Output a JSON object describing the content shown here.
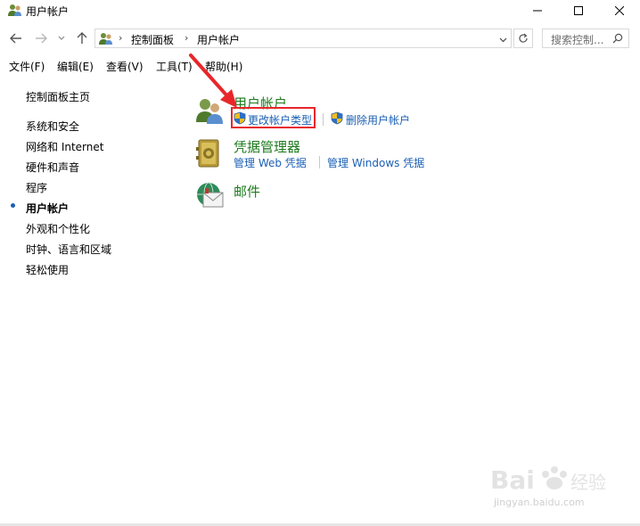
{
  "window": {
    "title": "用户帐户",
    "controls": {
      "minimize": "minimize-icon",
      "maximize": "maximize-icon",
      "close": "close-icon"
    }
  },
  "address_bar": {
    "breadcrumbs": [
      "控制面板",
      "用户帐户"
    ],
    "search_placeholder": "搜索控制..."
  },
  "menu": {
    "items": [
      "文件(F)",
      "编辑(E)",
      "查看(V)",
      "工具(T)",
      "帮助(H)"
    ]
  },
  "sidebar": {
    "home": "控制面板主页",
    "items": [
      {
        "label": "系统和安全",
        "current": false
      },
      {
        "label": "网络和 Internet",
        "current": false
      },
      {
        "label": "硬件和声音",
        "current": false
      },
      {
        "label": "程序",
        "current": false
      },
      {
        "label": "用户帐户",
        "current": true
      },
      {
        "label": "外观和个性化",
        "current": false
      },
      {
        "label": "时钟、语言和区域",
        "current": false
      },
      {
        "label": "轻松使用",
        "current": false
      }
    ]
  },
  "categories": [
    {
      "title": "用户帐户",
      "icon": "users-icon",
      "tasks": [
        {
          "label": "更改帐户类型",
          "icon": "uac-shield-icon"
        },
        {
          "label": "删除用户帐户",
          "icon": "uac-shield-icon"
        }
      ]
    },
    {
      "title": "凭据管理器",
      "icon": "vault-icon",
      "tasks": [
        {
          "label": "管理 Web 凭据"
        },
        {
          "label": "管理 Windows 凭据"
        }
      ]
    },
    {
      "title": "邮件",
      "icon": "mail-icon",
      "tasks": []
    }
  ],
  "watermark": {
    "logo": "Bai 经验",
    "url": "jingyan.baidu.com"
  },
  "colors": {
    "category_title": "#1e7b1e",
    "link": "#1a5fb4",
    "highlight": "#e8262a"
  }
}
